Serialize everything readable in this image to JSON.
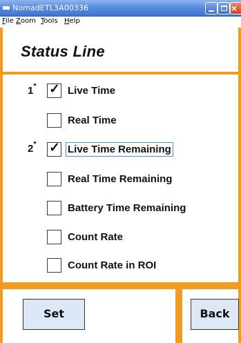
{
  "window": {
    "title": "NomadETL3A00336",
    "controls": {
      "close_glyph": "×"
    }
  },
  "menu": {
    "items": [
      "File",
      "Zoom",
      "Tools",
      "Help"
    ]
  },
  "page": {
    "heading": "Status Line"
  },
  "options": [
    {
      "marker": "1",
      "marker_sup": "*",
      "label": "Live Time",
      "checked": true,
      "focused": false
    },
    {
      "marker": "",
      "marker_sup": "",
      "label": "Real Time",
      "checked": false,
      "focused": false
    },
    {
      "marker": "2",
      "marker_sup": "*",
      "label": "Live Time Remaining",
      "checked": true,
      "focused": true
    },
    {
      "marker": "",
      "marker_sup": "",
      "label": "Real Time Remaining",
      "checked": false,
      "focused": false
    },
    {
      "marker": "",
      "marker_sup": "",
      "label": "Battery Time Remaining",
      "checked": false,
      "focused": false
    },
    {
      "marker": "",
      "marker_sup": "",
      "label": "Count Rate",
      "checked": false,
      "focused": false
    },
    {
      "marker": "",
      "marker_sup": "",
      "label": "Count Rate in ROI",
      "checked": false,
      "focused": false
    }
  ],
  "buttons": {
    "set_label": "Set",
    "back_label": "Back"
  },
  "colors": {
    "accent": "#f39a1f",
    "titlebar": "#3e73d1",
    "button_bg": "#dce8f6",
    "focus_outline": "#4a8fd6"
  },
  "icons": {
    "app": "window-icon",
    "check": "checkmark-icon"
  }
}
